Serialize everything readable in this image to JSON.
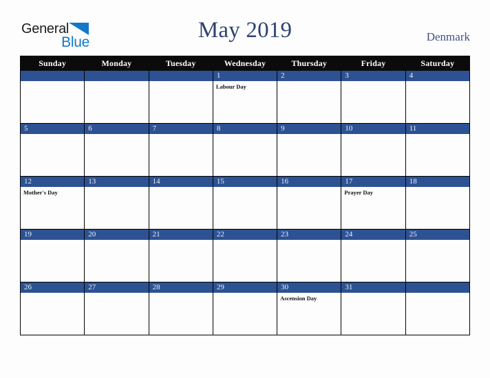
{
  "brand": {
    "name_part1": "General",
    "name_part2": "Blue",
    "triangle_icon": "blue-triangle-icon",
    "color_dark": "#1c1c1c",
    "color_blue": "#1378c8"
  },
  "header": {
    "title": "May 2019",
    "country": "Denmark",
    "title_color": "#2e4272",
    "country_color": "#3c5380"
  },
  "calendar": {
    "month": "May",
    "year": "2019",
    "header_bg": "#0b0b0b",
    "daynum_bg": "#2d5293",
    "cell_bg": "#fdfdfd",
    "weekdays": [
      "Sunday",
      "Monday",
      "Tuesday",
      "Wednesday",
      "Thursday",
      "Friday",
      "Saturday"
    ],
    "weeks": [
      [
        {
          "day": "",
          "events": []
        },
        {
          "day": "",
          "events": []
        },
        {
          "day": "",
          "events": []
        },
        {
          "day": "1",
          "events": [
            "Labour Day"
          ]
        },
        {
          "day": "2",
          "events": []
        },
        {
          "day": "3",
          "events": []
        },
        {
          "day": "4",
          "events": []
        }
      ],
      [
        {
          "day": "5",
          "events": []
        },
        {
          "day": "6",
          "events": []
        },
        {
          "day": "7",
          "events": []
        },
        {
          "day": "8",
          "events": []
        },
        {
          "day": "9",
          "events": []
        },
        {
          "day": "10",
          "events": []
        },
        {
          "day": "11",
          "events": []
        }
      ],
      [
        {
          "day": "12",
          "events": [
            "Mother's Day"
          ]
        },
        {
          "day": "13",
          "events": []
        },
        {
          "day": "14",
          "events": []
        },
        {
          "day": "15",
          "events": []
        },
        {
          "day": "16",
          "events": []
        },
        {
          "day": "17",
          "events": [
            "Prayer Day"
          ]
        },
        {
          "day": "18",
          "events": []
        }
      ],
      [
        {
          "day": "19",
          "events": []
        },
        {
          "day": "20",
          "events": []
        },
        {
          "day": "21",
          "events": []
        },
        {
          "day": "22",
          "events": []
        },
        {
          "day": "23",
          "events": []
        },
        {
          "day": "24",
          "events": []
        },
        {
          "day": "25",
          "events": []
        }
      ],
      [
        {
          "day": "26",
          "events": []
        },
        {
          "day": "27",
          "events": []
        },
        {
          "day": "28",
          "events": []
        },
        {
          "day": "29",
          "events": []
        },
        {
          "day": "30",
          "events": [
            "Ascension Day"
          ]
        },
        {
          "day": "31",
          "events": []
        },
        {
          "day": "",
          "events": []
        }
      ]
    ]
  }
}
